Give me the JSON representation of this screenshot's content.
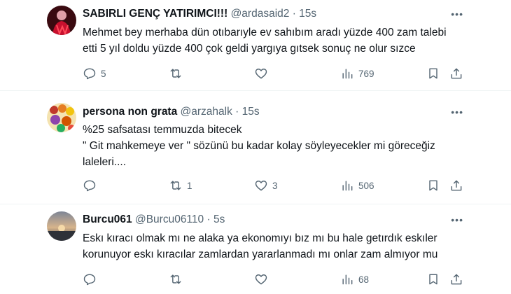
{
  "tweets": [
    {
      "name": "SABIRLI GENÇ YATIRIMCI!!!",
      "handle": "@ardasaid2",
      "separator": "·",
      "time": "15s",
      "lines": [
        "Mehmet bey merhaba dün otıbarıyle ev sahıbım aradı yüzde 400 zam talebi",
        "etti 5 yıl doldu yüzde 400 çok geldi yargıya gıtsek sonuç ne olur sızce"
      ],
      "replies": "5",
      "retweets": "",
      "likes": "",
      "views": "769",
      "avatar_colors": [
        "#7a0e1a",
        "#d11a2a",
        "#f3b8c0"
      ]
    },
    {
      "name": "persona non grata",
      "handle": "@arzahalk",
      "separator": "·",
      "time": "15s",
      "lines": [
        "%25 safsatası temmuzda bitecek",
        "\" Git mahkemeye ver \" sözünü bu kadar kolay söyleyecekler mi göreceğiz",
        "laleleri...."
      ],
      "replies": "",
      "retweets": "1",
      "likes": "3",
      "views": "506",
      "avatar_colors": [
        "#b8860b",
        "#e8c060",
        "#7a3d1a"
      ]
    },
    {
      "name": "Burcu061",
      "handle": "@Burcu06110",
      "separator": "·",
      "time": "5s",
      "lines": [
        "Eskı kıracı olmak mı ne alaka ya ekonomıyı bız mı bu hale getırdık eskıler",
        "korunuyor eskı kıracılar zamlardan yararlanmadı mı onlar zam almıyor mu"
      ],
      "replies": "",
      "retweets": "",
      "likes": "",
      "views": "68",
      "avatar_colors": [
        "#5a5f6a",
        "#c9a27a",
        "#2c2f36"
      ]
    }
  ],
  "more_label": "•••"
}
